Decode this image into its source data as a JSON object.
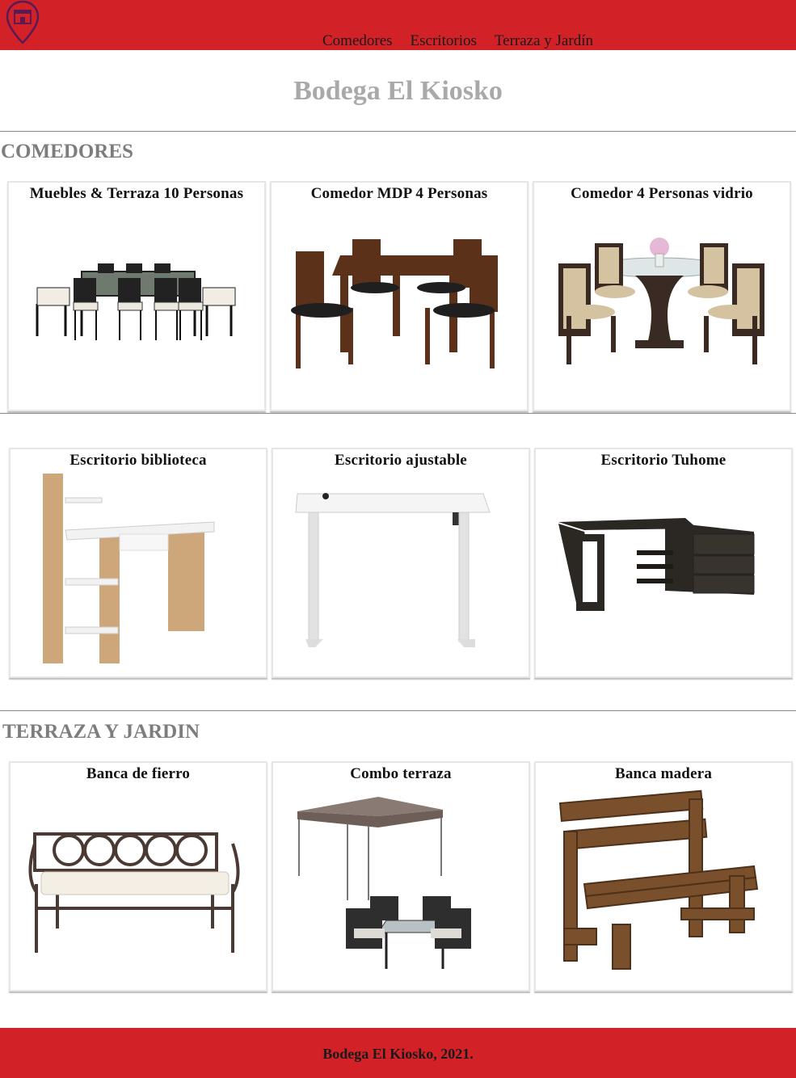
{
  "header": {
    "logo_icon": "store-location-pin-icon",
    "nav": [
      "Comedores",
      "Escritorios",
      "Terraza y Jardín"
    ]
  },
  "site_title": "Bodega El Kiosko",
  "sections": [
    {
      "title": "COMEDORES",
      "products": [
        {
          "name": "Muebles & Terraza 10 Personas",
          "image": "metal-dining-set-image"
        },
        {
          "name": "Comedor MDP 4 Personas",
          "image": "wood-dining-set-image"
        },
        {
          "name": "Comedor 4 Personas vidrio",
          "image": "glass-dining-set-image"
        }
      ]
    },
    {
      "title": "",
      "products": [
        {
          "name": "Escritorio biblioteca",
          "image": "bookshelf-desk-image"
        },
        {
          "name": "Escritorio ajustable",
          "image": "standing-desk-image"
        },
        {
          "name": "Escritorio Tuhome",
          "image": "corner-desk-image"
        }
      ]
    },
    {
      "title": "TERRAZA Y JARDIN",
      "products": [
        {
          "name": "Banca de fierro",
          "image": "iron-bench-image"
        },
        {
          "name": "Combo terraza",
          "image": "gazebo-combo-image"
        },
        {
          "name": "Banca madera",
          "image": "wood-bench-image"
        }
      ]
    }
  ],
  "footer": {
    "text": "Bodega El Kiosko, 2021."
  },
  "colors": {
    "brand_red": "#d22227",
    "title_gray": "#a9a9a9",
    "section_gray": "#7d7d7d"
  }
}
